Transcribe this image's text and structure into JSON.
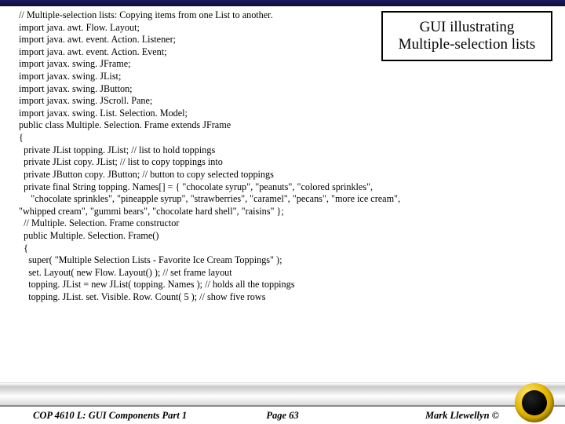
{
  "callout": {
    "line1": "GUI illustrating",
    "line2": "Multiple-selection lists"
  },
  "code": {
    "l01": "// Multiple-selection lists: Copying items from one List to another.",
    "l02": "import java. awt. Flow. Layout;",
    "l03": "import java. awt. event. Action. Listener;",
    "l04": "import java. awt. event. Action. Event;",
    "l05": "import javax. swing. JFrame;",
    "l06": "import javax. swing. JList;",
    "l07": "import javax. swing. JButton;",
    "l08": "import javax. swing. JScroll. Pane;",
    "l09": "import javax. swing. List. Selection. Model;",
    "l10": "",
    "l11": "public class Multiple. Selection. Frame extends JFrame",
    "l12": "{",
    "l13": "  private JList topping. JList; // list to hold toppings",
    "l14": "  private JList copy. JList; // list to copy toppings into",
    "l15": "  private JButton copy. JButton; // button to copy selected toppings",
    "l16": "  private final String topping. Names[] = { \"chocolate syrup\", \"peanuts\", \"colored sprinkles\",",
    "l17": "     \"chocolate sprinkles\", \"pineapple syrup\", \"strawberries\", \"caramel\", \"pecans\", \"more ice cream\",",
    "l18": "\"whipped cream\", \"gummi bears\", \"chocolate hard shell\", \"raisins\" };",
    "l19": "",
    "l20": "  // Multiple. Selection. Frame constructor",
    "l21": "  public Multiple. Selection. Frame()",
    "l22": "  {",
    "l23": "    super( \"Multiple Selection Lists - Favorite Ice Cream Toppings\" );",
    "l24": "    set. Layout( new Flow. Layout() ); // set frame layout",
    "l25": "",
    "l26": "    topping. JList = new JList( topping. Names ); // holds all the toppings",
    "l27": "    topping. JList. set. Visible. Row. Count( 5 ); // show five rows"
  },
  "footer": {
    "left": "COP 4610 L: GUI Components Part 1",
    "center": "Page 63",
    "right": "Mark Llewellyn ©"
  }
}
